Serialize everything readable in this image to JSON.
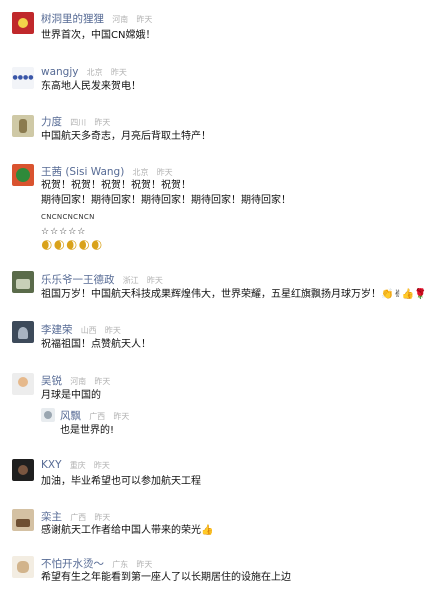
{
  "comments": [
    {
      "name": "树洞里的狸狸",
      "location": "河南",
      "time": "昨天",
      "lines": [
        "世界首次，中国CN嫦娥！"
      ]
    },
    {
      "name": "wangjy",
      "location": "北京",
      "time": "昨天",
      "lines": [
        "东高地人民发来贺电！"
      ]
    },
    {
      "name": "力度",
      "location": "四川",
      "time": "昨天",
      "lines": [
        "中国航天多奇志，月亮后背取土特产！"
      ]
    },
    {
      "name": "王茜 (Sisi Wang)",
      "location": "北京",
      "time": "昨天",
      "lines": [
        "祝贺！祝贺！祝贺！祝贺！祝贺！",
        "期待回家！期待回家！期待回家！期待回家！期待回家！",
        "CNCNCNCNCN",
        "☆☆☆☆☆",
        "🌒🌒🌒🌒🌒"
      ]
    },
    {
      "name": "乐乐爷一王德政",
      "location": "浙江",
      "time": "昨天",
      "lines": [
        "祖国万岁！中国航天科技成果辉煌伟大，世界荣耀，五星红旗飘扬月球万岁！👏✌👍🌹"
      ]
    },
    {
      "name": "李建荣",
      "location": "山西",
      "time": "昨天",
      "lines": [
        "祝福祖国！点赞航天人！"
      ]
    },
    {
      "name": "吴锐",
      "location": "河南",
      "time": "昨天",
      "lines": [
        "月球是中国的"
      ]
    },
    {
      "name": "KXY",
      "location": "重庆",
      "time": "昨天",
      "lines": [
        "加油，毕业希望也可以参加航天工程"
      ]
    },
    {
      "name": "栾主",
      "location": "广西",
      "time": "昨天",
      "lines": [
        "感谢航天工作者给中国人带来的荣光👍"
      ]
    },
    {
      "name": "不怕开水烫～",
      "location": "广东",
      "time": "昨天",
      "lines": [
        "希望有生之年能看到第一座人了以长期居住的设施在上边"
      ]
    }
  ],
  "reply": {
    "name": "风飘",
    "location": "广西",
    "time": "昨天",
    "text": "也是世界的!"
  }
}
